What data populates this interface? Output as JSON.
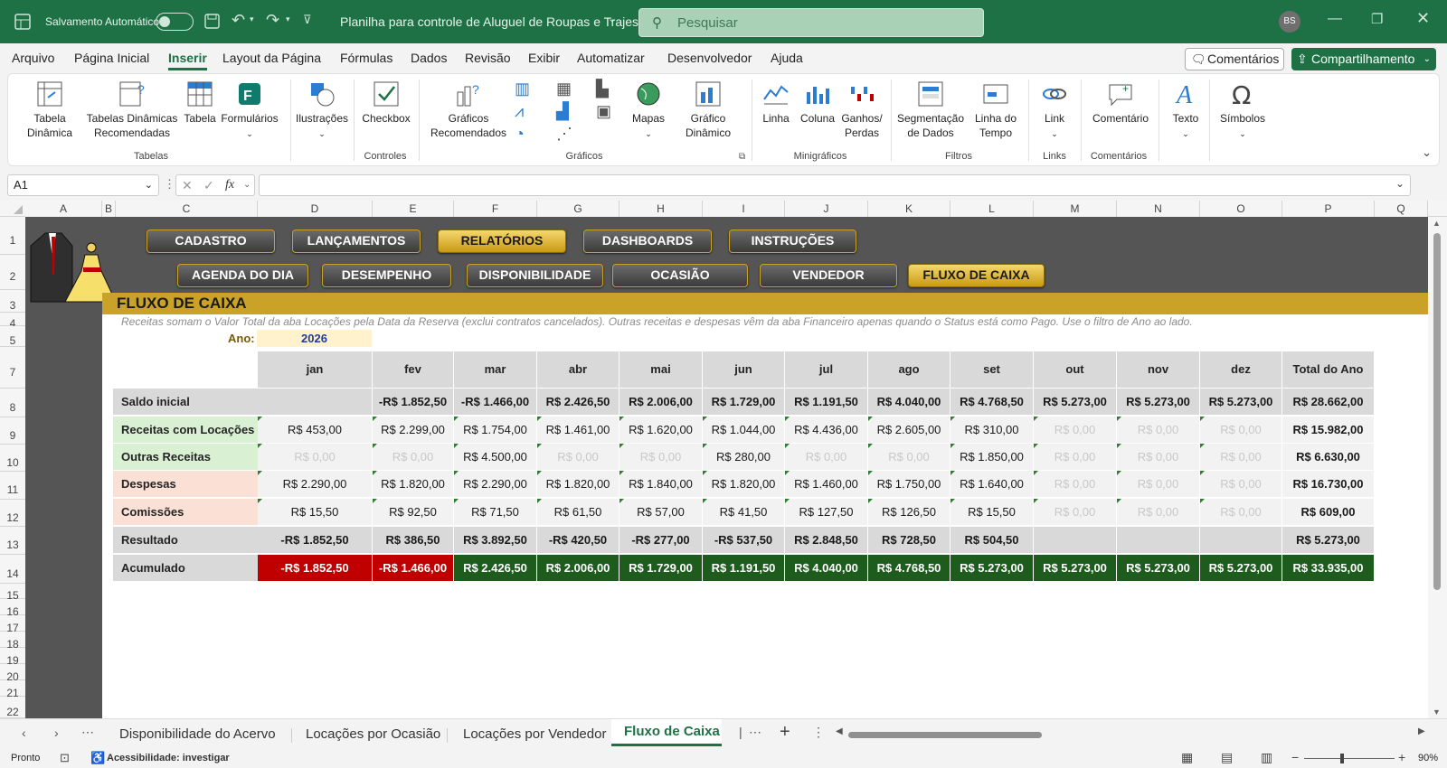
{
  "titlebar": {
    "autosave": "Salvamento Automático",
    "filename": "Planilha para controle de Aluguel de Roupas e Trajes",
    "search_placeholder": "Pesquisar",
    "avatar": "BS"
  },
  "menu": {
    "items": [
      "Arquivo",
      "Página Inicial",
      "Inserir",
      "Layout da Página",
      "Fórmulas",
      "Dados",
      "Revisão",
      "Exibir",
      "Automatizar",
      "Desenvolvedor",
      "Ajuda"
    ],
    "active": "Inserir",
    "comments": "Comentários",
    "share": "Compartilhamento"
  },
  "ribbon": {
    "tabela_dinamica": "Tabela Dinâmica",
    "tabelas_recomendadas": "Tabelas Dinâmicas Recomendadas",
    "tabela": "Tabela",
    "formularios": "Formulários",
    "grp_tabelas": "Tabelas",
    "ilustracoes": "Ilustrações",
    "checkbox": "Checkbox",
    "grp_controles": "Controles",
    "graficos_recomendados": "Gráficos Recomendados",
    "mapas": "Mapas",
    "grafico_dinamico": "Gráfico Dinâmico",
    "grp_graficos": "Gráficos",
    "linha": "Linha",
    "coluna": "Coluna",
    "ganhos": "Ganhos/ Perdas",
    "grp_minigraficos": "Minigráficos",
    "segmentacao": "Segmentação de Dados",
    "linha_tempo": "Linha do Tempo",
    "grp_filtros": "Filtros",
    "link": "Link",
    "grp_links": "Links",
    "comentario": "Comentário",
    "grp_comentarios": "Comentários",
    "texto": "Texto",
    "simbolos": "Símbolos"
  },
  "formula": {
    "namebox": "A1",
    "value": ""
  },
  "columns": [
    "A",
    "B",
    "C",
    "D",
    "E",
    "F",
    "G",
    "H",
    "I",
    "J",
    "K",
    "L",
    "M",
    "N",
    "O",
    "P",
    "Q"
  ],
  "rows": [
    "1",
    "2",
    "3",
    "4",
    "5",
    "7",
    "8",
    "9",
    "10",
    "11",
    "12",
    "13",
    "14",
    "15",
    "16",
    "17",
    "18",
    "19",
    "20",
    "21",
    "22"
  ],
  "nav_row1": [
    "CADASTRO",
    "LANÇAMENTOS",
    "RELATÓRIOS",
    "DASHBOARDS",
    "INSTRUÇÕES"
  ],
  "nav_row2": [
    "AGENDA DO DIA",
    "DESEMPENHO",
    "DISPONIBILIDADE",
    "OCASIÃO",
    "VENDEDOR",
    "FLUXO DE CAIXA"
  ],
  "report": {
    "title": "FLUXO DE CAIXA",
    "note": "Receitas somam o Valor Total da aba Locações pela Data da Reserva (exclui contratos cancelados). Outras receitas e despesas vêm da aba Financeiro apenas quando o Status está como Pago. Use o filtro de Ano ao lado.",
    "ano_label": "Ano:",
    "ano_value": "2026"
  },
  "table": {
    "headers": [
      "jan",
      "fev",
      "mar",
      "abr",
      "mai",
      "jun",
      "jul",
      "ago",
      "set",
      "out",
      "nov",
      "dez",
      "Total do Ano"
    ],
    "rows": [
      {
        "label": "Saldo inicial",
        "values": [
          "",
          "-R$ 1.852,50",
          "-R$ 1.466,00",
          "R$ 2.426,50",
          "R$ 2.006,00",
          "R$ 1.729,00",
          "R$ 1.191,50",
          "R$ 4.040,00",
          "R$ 4.768,50",
          "R$ 5.273,00",
          "R$ 5.273,00",
          "R$ 5.273,00",
          "R$ 28.662,00"
        ]
      },
      {
        "label": "Receitas com Locações",
        "values": [
          "R$ 453,00",
          "R$ 2.299,00",
          "R$ 1.754,00",
          "R$ 1.461,00",
          "R$ 1.620,00",
          "R$ 1.044,00",
          "R$ 4.436,00",
          "R$ 2.605,00",
          "R$ 310,00",
          "R$ 0,00",
          "R$ 0,00",
          "R$ 0,00",
          "R$ 15.982,00"
        ]
      },
      {
        "label": "Outras Receitas",
        "values": [
          "R$ 0,00",
          "R$ 0,00",
          "R$ 4.500,00",
          "R$ 0,00",
          "R$ 0,00",
          "R$ 280,00",
          "R$ 0,00",
          "R$ 0,00",
          "R$ 1.850,00",
          "R$ 0,00",
          "R$ 0,00",
          "R$ 0,00",
          "R$ 6.630,00"
        ]
      },
      {
        "label": "Despesas",
        "values": [
          "R$ 2.290,00",
          "R$ 1.820,00",
          "R$ 2.290,00",
          "R$ 1.820,00",
          "R$ 1.840,00",
          "R$ 1.820,00",
          "R$ 1.460,00",
          "R$ 1.750,00",
          "R$ 1.640,00",
          "R$ 0,00",
          "R$ 0,00",
          "R$ 0,00",
          "R$ 16.730,00"
        ]
      },
      {
        "label": "Comissões",
        "values": [
          "R$ 15,50",
          "R$ 92,50",
          "R$ 71,50",
          "R$ 61,50",
          "R$ 57,00",
          "R$ 41,50",
          "R$ 127,50",
          "R$ 126,50",
          "R$ 15,50",
          "R$ 0,00",
          "R$ 0,00",
          "R$ 0,00",
          "R$ 609,00"
        ]
      },
      {
        "label": "Resultado",
        "values": [
          "-R$ 1.852,50",
          "R$ 386,50",
          "R$ 3.892,50",
          "-R$ 420,50",
          "-R$ 277,00",
          "-R$ 537,50",
          "R$ 2.848,50",
          "R$ 728,50",
          "R$ 504,50",
          "",
          "",
          "",
          "R$ 5.273,00"
        ]
      },
      {
        "label": "Acumulado",
        "values": [
          "-R$ 1.852,50",
          "-R$ 1.466,00",
          "R$ 2.426,50",
          "R$ 2.006,00",
          "R$ 1.729,00",
          "R$ 1.191,50",
          "R$ 4.040,00",
          "R$ 4.768,50",
          "R$ 5.273,00",
          "R$ 5.273,00",
          "R$ 5.273,00",
          "R$ 5.273,00",
          "R$ 33.935,00"
        ]
      }
    ]
  },
  "tabs": {
    "items": [
      "Disponibilidade do Acervo",
      "Locações por Ocasião",
      "Locações por Vendedor",
      "Fluxo de Caixa"
    ],
    "active": "Fluxo de Caixa"
  },
  "status": {
    "ready": "Pronto",
    "accessibility": "Acessibilidade: investigar",
    "zoom": "90%"
  },
  "colors": {
    "green": "#1e7145",
    "gold": "#c9a227",
    "dark": "#555555",
    "neg": "#c00000",
    "pos": "#1e5c1e"
  }
}
